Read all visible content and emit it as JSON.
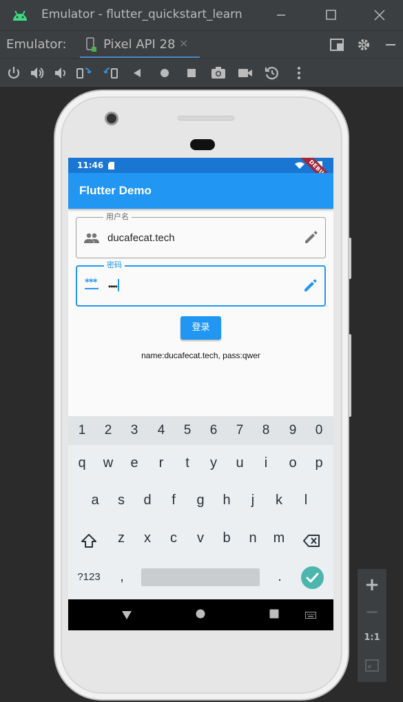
{
  "window": {
    "title": "Emulator - flutter_quickstart_learn",
    "minimize_icon": "minimize-icon",
    "maximize_icon": "maximize-icon",
    "close_icon": "close-icon"
  },
  "tabbar": {
    "label": "Emulator:",
    "tab_label": "Pixel API 28",
    "tab_close": "×"
  },
  "toolbar": {
    "tools": [
      "power-icon",
      "volume-up-icon",
      "volume-down-icon",
      "rotate-left-icon",
      "rotate-right-icon",
      "back-icon",
      "home-icon",
      "overview-icon",
      "screenshot-icon",
      "screen-record-icon",
      "snapshot-icon",
      "more-icon"
    ]
  },
  "device": {
    "status_time": "11:46",
    "debug_banner": "DEBUG",
    "app_title": "Flutter Demo",
    "username": {
      "label": "用户名",
      "value": "ducafecat.tech"
    },
    "password": {
      "label": "密码",
      "lead_text": "***",
      "value": "••••"
    },
    "login_button": "登录",
    "result_text": "name:ducafecat.tech, pass:qwer"
  },
  "keyboard": {
    "numbers": [
      "1",
      "2",
      "3",
      "4",
      "5",
      "6",
      "7",
      "8",
      "9",
      "0"
    ],
    "row1": [
      "q",
      "w",
      "e",
      "r",
      "t",
      "y",
      "u",
      "i",
      "o",
      "p"
    ],
    "row2": [
      "a",
      "s",
      "d",
      "f",
      "g",
      "h",
      "j",
      "k",
      "l"
    ],
    "row3": [
      "z",
      "x",
      "c",
      "v",
      "b",
      "n",
      "m"
    ],
    "symbols_key": "?123",
    "comma_key": ",",
    "period_key": "."
  },
  "zoom": {
    "zoom_in": "+",
    "zoom_out": "−",
    "one_to_one": "1:1"
  },
  "colors": {
    "ide_background": "#2b2b2b",
    "ide_chrome": "#3c3f41",
    "accent_blue": "#2196f3",
    "status_bar": "#1976d2",
    "enter_key": "#4db6ac",
    "android_green": "#3ddc84"
  }
}
